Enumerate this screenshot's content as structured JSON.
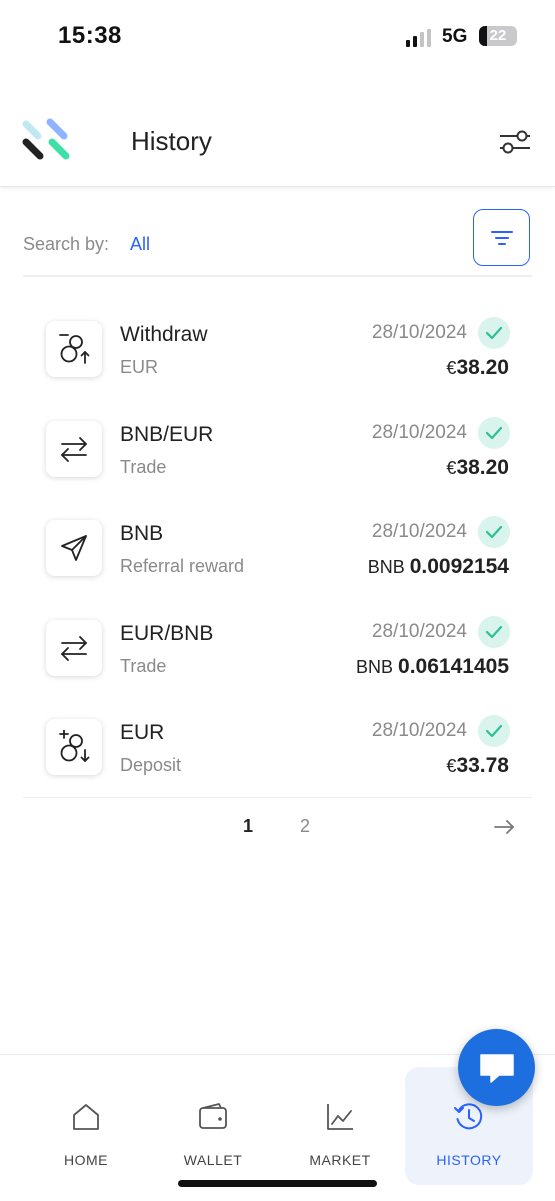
{
  "status_bar": {
    "time": "15:38",
    "network": "5G",
    "battery": "22"
  },
  "header": {
    "title": "History"
  },
  "search": {
    "label": "Search by:",
    "value": "All"
  },
  "transactions": [
    {
      "icon": "withdraw-icon",
      "title": "Withdraw",
      "subtitle": "EUR",
      "date": "28/10/2024",
      "currency": "€",
      "amount": "38.20"
    },
    {
      "icon": "swap-arrows-icon",
      "title": "BNB/EUR",
      "subtitle": "Trade",
      "date": "28/10/2024",
      "currency": "€",
      "amount": "38.20"
    },
    {
      "icon": "send-plane-icon",
      "title": "BNB",
      "subtitle": "Referral reward",
      "date": "28/10/2024",
      "currency": "BNB ",
      "amount": "0.0092154"
    },
    {
      "icon": "swap-arrows-icon",
      "title": "EUR/BNB",
      "subtitle": "Trade",
      "date": "28/10/2024",
      "currency": "BNB ",
      "amount": "0.06141405"
    },
    {
      "icon": "deposit-icon",
      "title": "EUR",
      "subtitle": "Deposit",
      "date": "28/10/2024",
      "currency": "€",
      "amount": "33.78"
    }
  ],
  "pagination": {
    "pages": [
      "1",
      "2"
    ],
    "current": "1"
  },
  "bottom_nav": [
    {
      "label": "HOME",
      "icon": "home-icon"
    },
    {
      "label": "WALLET",
      "icon": "wallet-icon"
    },
    {
      "label": "MARKET",
      "icon": "chart-icon"
    },
    {
      "label": "HISTORY",
      "icon": "history-icon",
      "active": true
    }
  ],
  "colors": {
    "accent": "#2962ff",
    "success": "#2fbf94",
    "success_bg": "#d8f4ec",
    "fab": "#1d6fe0"
  }
}
